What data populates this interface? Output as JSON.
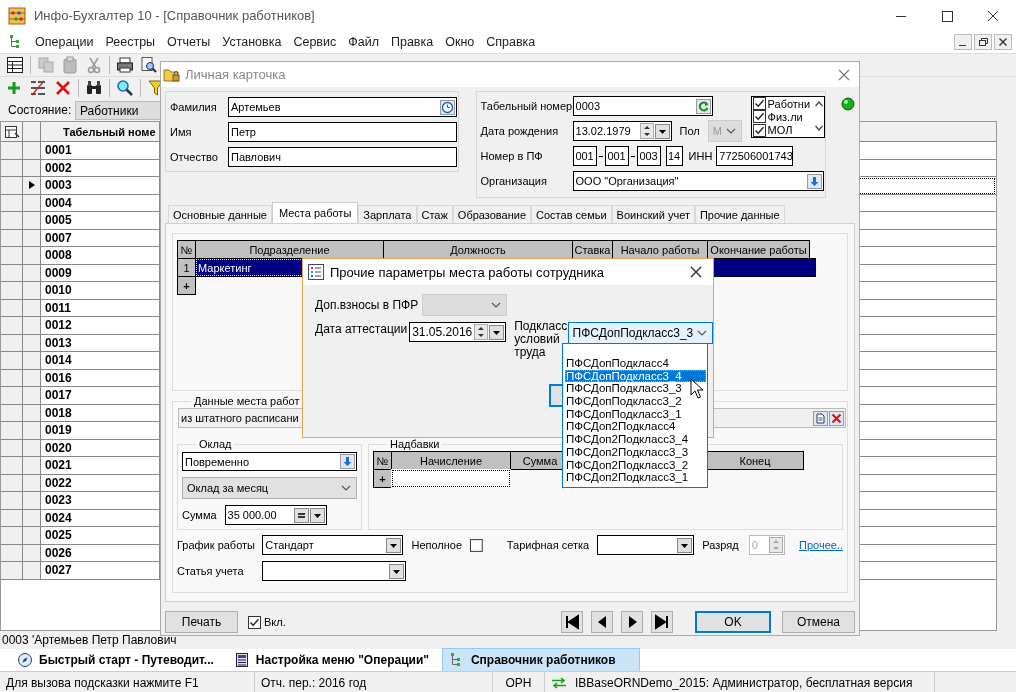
{
  "window": {
    "title": "Инфо-Бухгалтер 10 - [Справочник работников]"
  },
  "menu": [
    "Операции",
    "Реестры",
    "Отчеты",
    "Установка",
    "Сервис",
    "Файл",
    "Правка",
    "Окно",
    "Справка"
  ],
  "filter": {
    "label": "Состояние:",
    "value": "Работники"
  },
  "grid": {
    "columns": [
      "Табельный номе"
    ],
    "rows": [
      {
        "number": "0001",
        "current": false
      },
      {
        "number": "0002",
        "current": false
      },
      {
        "number": "0003",
        "current": true
      },
      {
        "number": "0004",
        "current": false
      },
      {
        "number": "0005",
        "current": false
      },
      {
        "number": "0007",
        "current": false
      },
      {
        "number": "0008",
        "current": false
      },
      {
        "number": "0009",
        "current": false
      },
      {
        "number": "0010",
        "current": false
      },
      {
        "number": "0011",
        "current": false
      },
      {
        "number": "0012",
        "current": false
      },
      {
        "number": "0013",
        "current": false
      },
      {
        "number": "0014",
        "current": false
      },
      {
        "number": "0016",
        "current": false
      },
      {
        "number": "0017",
        "current": false
      },
      {
        "number": "0018",
        "current": false
      },
      {
        "number": "0019",
        "current": false
      },
      {
        "number": "0020",
        "current": false
      },
      {
        "number": "0021",
        "current": false
      },
      {
        "number": "0022",
        "current": false
      },
      {
        "number": "0023",
        "current": false
      },
      {
        "number": "0024",
        "current": false
      },
      {
        "number": "0025",
        "current": false
      },
      {
        "number": "0026",
        "current": false
      },
      {
        "number": "0027",
        "current": false
      }
    ]
  },
  "record_caption": "0003 'Артемьев Петр Павлович",
  "taskbar": [
    {
      "label": "Быстрый старт - Путеводит...",
      "selected": false
    },
    {
      "label": "Настройка меню \"Операции\"",
      "selected": false
    },
    {
      "label": "Справочник работников",
      "selected": true
    }
  ],
  "status_bar": [
    "Для вызова подсказки нажмите F1",
    "Отч. пер.: 2016 год",
    "ОРН",
    "IBBaseORNDemo_2015: Администратор, бесплатная версия"
  ],
  "card": {
    "title": "Личная карточка",
    "name_fields": [
      {
        "label": "Фамилия",
        "value": "Артемьев"
      },
      {
        "label": "Имя",
        "value": "Петр"
      },
      {
        "label": "Отчество",
        "value": "Павлович"
      }
    ],
    "tab_number": {
      "label": "Табельный номер",
      "value": "0003"
    },
    "birth_date": {
      "label": "Дата рождения",
      "value": "13.02.1979"
    },
    "sex": {
      "label": "Пол",
      "value": "М",
      "disabled": true
    },
    "roles": [
      {
        "label": "Работни",
        "checked": true
      },
      {
        "label": "Физ.ли",
        "checked": true
      },
      {
        "label": "МОЛ",
        "checked": true
      }
    ],
    "pf_number": {
      "label": "Номер в ПФ",
      "parts": [
        "001",
        "001",
        "003",
        "14"
      ]
    },
    "inn": {
      "label": "ИНН",
      "value": "772506001743"
    },
    "organization": {
      "label": "Организация",
      "value": "ООО \"Организация\""
    },
    "tabs": [
      {
        "label": "Основные данные",
        "selected": false
      },
      {
        "label": "Места работы",
        "selected": true
      },
      {
        "label": "Зарплата",
        "selected": false
      },
      {
        "label": "Стаж",
        "selected": false
      },
      {
        "label": "Образование",
        "selected": false
      },
      {
        "label": "Состав семьи",
        "selected": false
      },
      {
        "label": "Воинский учет",
        "selected": false
      },
      {
        "label": "Прочие данные",
        "selected": false
      }
    ],
    "jobs": {
      "columns": [
        "№",
        "Подразделение",
        "Должность",
        "Ставка",
        "Начало работы",
        "Окончание работы"
      ],
      "rows": [
        {
          "number": "1",
          "department": "Маркетинг",
          "selected": true
        }
      ],
      "add": "+"
    },
    "place": {
      "title": "Данные места работ",
      "source": "из штатного расписани"
    },
    "salary": {
      "title": "Оклад",
      "mode": "Повременно",
      "type": "Оклад за месяц",
      "sum_label": "Сумма",
      "sum": "35 000.00"
    },
    "bonuses": {
      "title": "Надбавки",
      "columns": [
        "№",
        "Начисление",
        "Сумма",
        "Конец"
      ],
      "add": "+"
    },
    "schedule": {
      "label": "График работы",
      "value": "Стандарт"
    },
    "part_time": {
      "label": "Неполное",
      "checked": false
    },
    "tariff": {
      "label": "Тарифная сетка"
    },
    "grade": {
      "label": "Разряд",
      "value": "0",
      "disabled": true
    },
    "more_link": "Прочее..",
    "account": {
      "label": "Статья учета"
    },
    "print_button": "Печать",
    "enabled": {
      "label": "Вкл.",
      "checked": true
    },
    "ok": "OK",
    "cancel": "Отмена"
  },
  "dialog": {
    "title": "Прочие параметры места работы сотрудника",
    "pfr": {
      "label": "Доп.взносы в ПФР",
      "disabled": true
    },
    "attestation": {
      "label": "Дата аттестации",
      "value": "31.05.2016"
    },
    "subclass": {
      "label": "Подкласс условий труда",
      "value": "ПФСДопПодкласс3_3",
      "options": [
        {
          "label": "ПФСДопПодкласс4",
          "highlighted": false
        },
        {
          "label": "ПФСДопПодкласс3_4",
          "highlighted": true
        },
        {
          "label": "ПФСДопПодкласс3_3",
          "highlighted": false
        },
        {
          "label": "ПФСДопПодкласс3_2",
          "highlighted": false
        },
        {
          "label": "ПФСДопПодкласс3_1",
          "highlighted": false
        },
        {
          "label": "ПФСДоп2Подкласс4",
          "highlighted": false
        },
        {
          "label": "ПФСДоп2Подкласс3_4",
          "highlighted": false
        },
        {
          "label": "ПФСДоп2Подкласс3_3",
          "highlighted": false
        },
        {
          "label": "ПФСДоп2Подкласс3_2",
          "highlighted": false
        },
        {
          "label": "ПФСДоп2Подкласс3_1",
          "highlighted": false
        }
      ]
    }
  }
}
